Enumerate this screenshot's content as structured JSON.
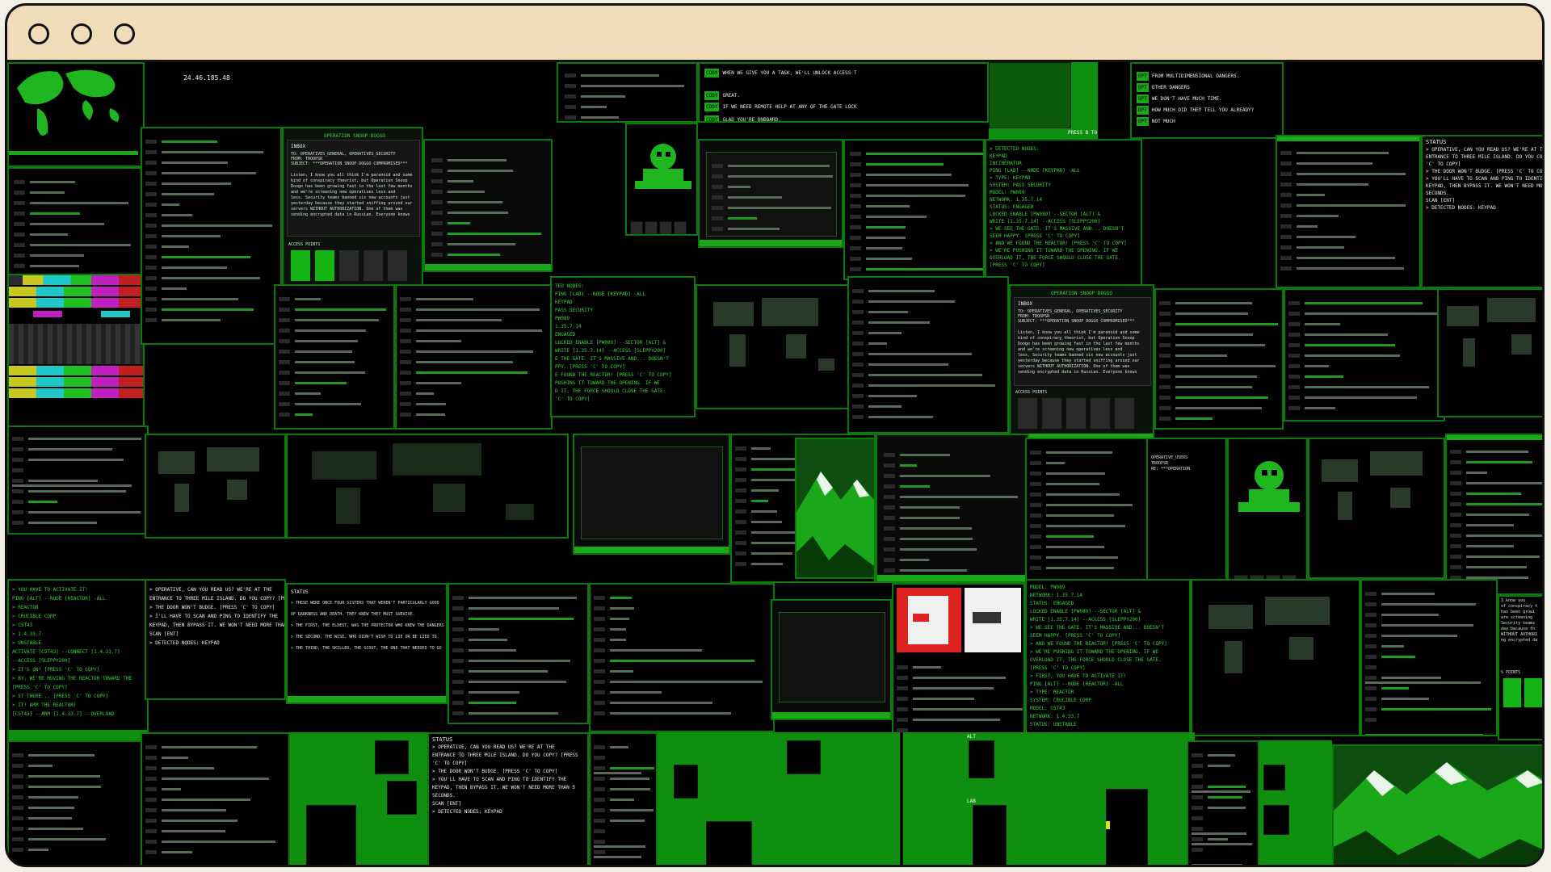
{
  "colors": {
    "accent": "#1aa81a",
    "titlebar": "#f0dcb8",
    "background": "#000000"
  },
  "window": {
    "controls": [
      "close",
      "minimize",
      "maximize"
    ]
  },
  "ip": "24.46.185.48",
  "email": {
    "header": "OPERATION SNOOP DOGGO",
    "label": "INBOX",
    "to": "TO: OPERATIVES_GENERAL, OPERATIVES_SECURITY",
    "from": "FROM: TROOPSR",
    "subject": "SUBJECT: ***OPERATION SNOOP DOGGO COMPROMISED***",
    "body": "Listen, I know you all think I'm paranoid and some\nkind of conspiracy theorist, but Operation Snoop\nDoogo has been growing fast in the last few months\nand we're screening new operatives less and\nless. Security teams banned six new accounts just\nyesterday because they started sniffing around our\nservers WITHOUT AUTHORIZATION. One of them was\nsending encrypted data in Russian. Everyone knows",
    "access": "ACCESS POINTS"
  },
  "dialog": [
    "WHEN WE GIVE YOU A TASK, WE'LL UNLOCK ACCESS T",
    "GREAT.",
    "IF WE NEED REMOTE HELP AT ANY OF THE GATE LOCK",
    "GLAD YOU'RE ONBOARD."
  ],
  "status_panel": {
    "label": "STATUS",
    "lines": [
      "> OPERATIVE, CAN YOU READ US? WE'RE AT THE",
      "ENTRANCE TO THREE MILE ISLAND. DO YOU COPY? [PRESS",
      "'C' TO COPY]",
      "> THE DOOR WON'T BUDGE. [PRESS 'C' TO COPY]",
      "> YOU'LL HAVE TO SCAN AND PING TO IDENTIFY THE",
      "KEYPAD, THEN BYPASS IT. WE WON'T NEED MORE THAN 5",
      "SECONDS.",
      "SCAN [ENT]",
      "> DETECTED NODES: KEYPAD"
    ]
  },
  "reactor_log": [
    "> DETECTED NODES:",
    "KEYPAD",
    "INCINERATOR",
    "PING [LAB] --NODE [KEYPAD] -ALL",
    "> TYPE: KEYPAD",
    "SYSTEM: PASS SECURITY",
    "MODEL: PW089",
    "NETWORK: 1.35.7.14",
    "STATUS: ENGAGED",
    "LOCKED ENABLE [PW089] --SECTOR [ALT] &",
    "WRITE [1.35.7.14] --ACCESS [SLEPPY200]",
    "> WE SEE THE GATE. IT'S MASSIVE AND... DOESN'T",
    "SEEM HAPPY. [PRESS 'C' TO COPY]",
    "> AND WE FOUND THE REACTOR! [PRESS 'C' TO COPY]",
    "> WE'RE PUSHING IT TOWARD THE OPENING. IF WE",
    "OVERLOAD IT, THE FORCE SHOULD CLOSE THE GATE.",
    "[PRESS 'C' TO COPY]"
  ],
  "reactor_log2": [
    "MODEL: PW089",
    "NETWORK: 1.35.7.14",
    "STATUS: ENGAGED",
    "LOCKED ENABLE [PW089] --SECTOR [ALT] &",
    "WRITE [1.35.7.14] --ACCESS [SLEPPY200]",
    "> WE SEE THE GATE. IT'S MASSIVE AND... DOESN'T",
    "SEEM HAPPY. [PRESS 'C' TO COPY]",
    "> AND WE FOUND THE REACTOR! [PRESS 'C' TO COPY]",
    "> WE'RE PUSHING IT TOWARD THE OPENING. IF WE",
    "OVERLOAD IT, THE FORCE SHOULD CLOSE THE GATE.",
    "[PRESS 'C' TO COPY]",
    "> FIRST, YOU HAVE TO ACTIVATE IT!",
    "PING [ALT] --NODE [REACTOR] -ALL",
    "> TYPE: REACTOR",
    "SYSTEM: CRUCIBLE CORP",
    "MODEL: CST43",
    "NETWORK: 1.4.33.7",
    "STATUS: UNSTABLE"
  ],
  "left_log": [
    "> YOU HAVE TO ACTIVATE IT!",
    "PING [ALT] --NODE [REACTOR] -ALL",
    "> REACTOR",
    "> CRUCIBLE CORP",
    "> CST43",
    "> 1.4.33.7",
    "> UNSTABLE",
    "ACTIVATE [CST43] --CONNECT [1.4.33.7]",
    "--ACCESS [SLEPPY200]",
    "> IT'S ON! [PRESS 'C' TO COPY]",
    "> BY, WE'RE MOVING THE REACTOR TOWARD THE",
    "[PRESS 'C' TO COPY]",
    "> ST THERE... [PRESS 'C' TO COPY]",
    "> IT! ARM THE REACTOR!",
    "[CST43] --ARM [1.4.33.7] --OVERLOAD"
  ],
  "mid_log": [
    "> OPERATIVE, CAN YOU READ US? WE'RE AT THE",
    "ENTRANCE TO THREE MILE ISLAND. DO YOU COPY? [PRESS",
    "> THE DOOR WON'T BUDGE. [PRESS 'C' TO COPY]",
    "> I'LL HAVE TO SCAN AND PING TO IDENTIFY THE",
    "KEYPAD, THEN BYPASS IT. WE WON'T NEED MORE THAN 5",
    "SCAN [ENT]",
    "> DETECTED NODES: KEYPAD"
  ],
  "mid_log2": [
    "TED NODES:",
    "PING [LAB] --NODE [KEYPAD] -ALL",
    "KEYPAD",
    "PASS SECURITY",
    "PW089",
    "1.35.7.14",
    "ENGAGED",
    "LOCKED ENABLE [PW089] --SECTOR [ALT] &",
    "WRITE [1.35.7.14] --ACCESS [SLEPPY200]",
    "E THE GATE. IT'S MASSIVE AND... DOESN'T",
    "PPY. [PRESS 'C' TO COPY]",
    "E FOUND THE REACTOR! [PRESS 'C' TO COPY]",
    "PUSHING IT TOWARD THE OPENING. IF WE",
    "D IT, THE FORCE SHOULD CLOSE THE GATE.",
    "'C' TO COPY]"
  ],
  "stories": [
    "> THESE WERE ONCE FOUR SISTERS THAT WEREN'T PARTICULARLY GOOD",
    "OF DARKNESS AND DEATH. THEY KNEW THEY MUST SURVIVE.",
    "> THE FIRST, THE ELDEST, WAS THE PROTECTOR WHO KNEW THE DANGERS",
    "> THE SECOND, THE WISE, WHO DIDN'T WISH TO LIE OR BE LIED TO.",
    "> THE THIRD, THE SKILLED, THE SCOUT, THE ONE THAT NEEDED TO GO"
  ],
  "options": [
    "FROM MULTIDIMENSIONAL DANGERS.",
    "OTHER DANGERS",
    "WE DON'T HAVE MUCH TIME.",
    "HOW MUCH DID THEY TELL YOU ALREADY?",
    "NOT MUCH"
  ],
  "press_b": "PRESS B TO",
  "labels": {
    "alt": "ALT",
    "lab": "LAB"
  },
  "status_headers": [
    "STATUS",
    "STATUS"
  ],
  "sign": "OPERATIVE_USERS\nTROOPSR\nRE: ***OPERATION",
  "sign_tail": "I know you\nof conspiracy t\nhas been growi\nare screening\nSecurity teams\nday because th\nWITHOUT AUTHORI\nng encrypted da",
  "points": "S POINTS"
}
